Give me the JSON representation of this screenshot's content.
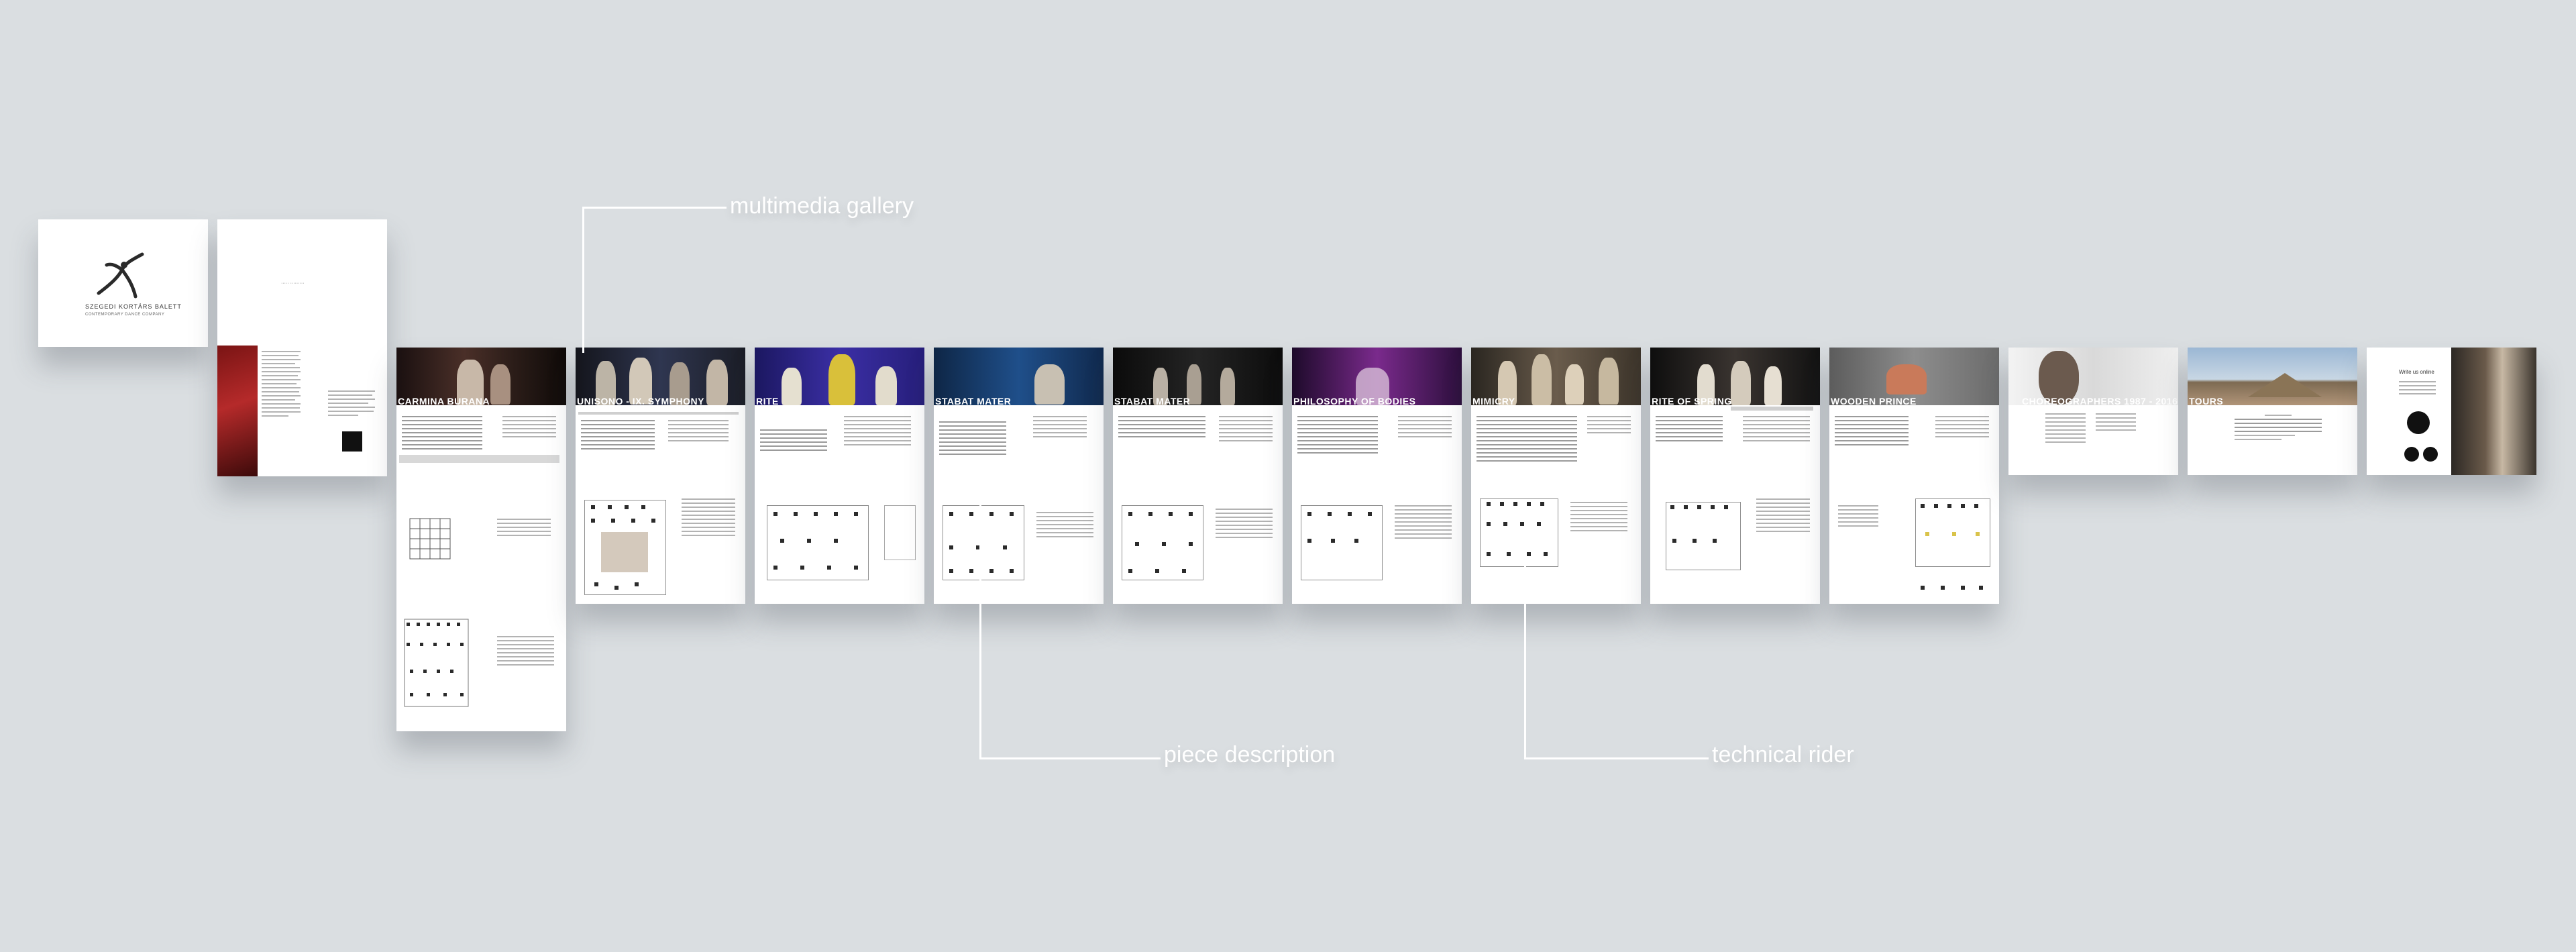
{
  "cover": {
    "brand_line1": "SZEGEDI KORTÁRS BALETT",
    "brand_line2": "CONTEMPORARY DANCE COMPANY"
  },
  "callouts": {
    "gallery": "multimedia gallery",
    "description": "piece description",
    "rider": "technical rider"
  },
  "pieces": [
    {
      "title": "CARMINA BURANA"
    },
    {
      "title": "UNISONO - IX. SYMPHONY"
    },
    {
      "title": "RITE"
    },
    {
      "title": "STABAT MATER"
    },
    {
      "title": "STABAT MATER"
    },
    {
      "title": "PHILOSOPHY OF BODIES"
    },
    {
      "title": "MIMICRY"
    },
    {
      "title": "RITE OF SPRING"
    },
    {
      "title": "WOODEN PRINCE"
    }
  ],
  "chapters": {
    "choreographers": "CHOREOGRAPHERS 1987 - 2016",
    "tours": "TOURS"
  },
  "contact": {
    "title": "Write us online"
  },
  "colors": {
    "background": "#dadee1",
    "callout": "#ffffff"
  }
}
